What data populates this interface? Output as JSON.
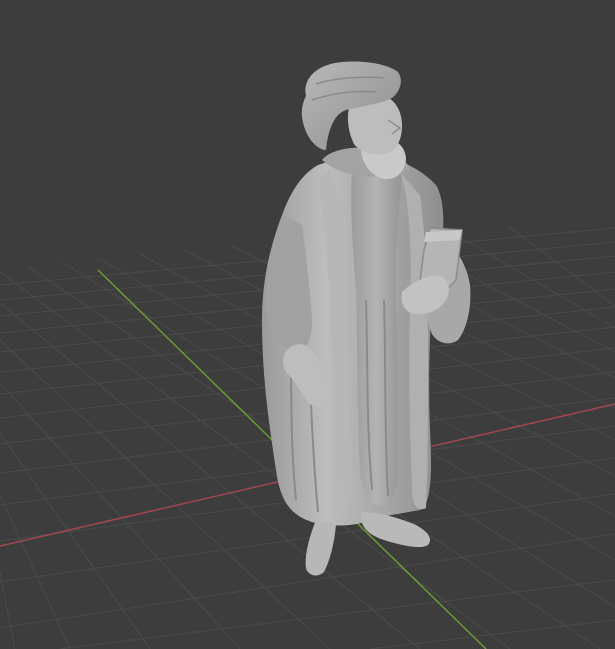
{
  "viewport": {
    "background": "#3d3d3d",
    "grid_color": "#4b4b4b",
    "x_axis_color": "#a3474f",
    "y_axis_color": "#6a9a34"
  },
  "object": {
    "icon": "statue-icon",
    "color": "#a7a7a7"
  }
}
